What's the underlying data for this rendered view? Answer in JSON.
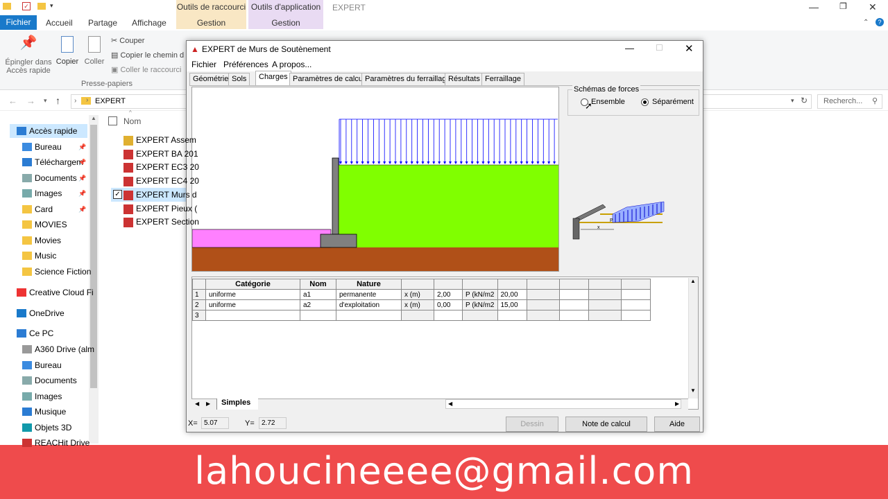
{
  "explorer": {
    "ctx_tabs": [
      {
        "label": "Outils de raccourci",
        "sub": "Gestion"
      },
      {
        "label": "Outils d'application",
        "sub": "Gestion"
      }
    ],
    "window_title": "EXPERT",
    "ribbon_tabs": [
      "Fichier",
      "Accueil",
      "Partage",
      "Affichage"
    ],
    "ribbon": {
      "pin_label": "Épingler dans Accès rapide",
      "copy_label": "Copier",
      "paste_label": "Coller",
      "cut_label": "Couper",
      "copy_path_label": "Copier le chemin d",
      "paste_shortcut_label": "Coller le raccourci",
      "group_label": "Presse-papiers"
    },
    "address": "EXPERT",
    "search_placeholder": "Recherch...",
    "nav_items": [
      {
        "label": "Accès rapide",
        "pinned": false
      },
      {
        "label": "Bureau",
        "pinned": true
      },
      {
        "label": "Téléchargem",
        "pinned": true
      },
      {
        "label": "Documents",
        "pinned": true
      },
      {
        "label": "Images",
        "pinned": true
      },
      {
        "label": "Card",
        "pinned": true
      },
      {
        "label": "MOVIES",
        "pinned": false
      },
      {
        "label": "Movies",
        "pinned": false
      },
      {
        "label": "Music",
        "pinned": false
      },
      {
        "label": "Science Fiction",
        "pinned": false
      },
      {
        "label": "Creative Cloud Fi",
        "pinned": false
      },
      {
        "label": "OneDrive",
        "pinned": false
      },
      {
        "label": "Ce PC",
        "pinned": false
      },
      {
        "label": "A360 Drive (alm",
        "pinned": false
      },
      {
        "label": "Bureau",
        "pinned": false
      },
      {
        "label": "Documents",
        "pinned": false
      },
      {
        "label": "Images",
        "pinned": false
      },
      {
        "label": "Musique",
        "pinned": false
      },
      {
        "label": "Objets 3D",
        "pinned": false
      },
      {
        "label": "REACHit Drive",
        "pinned": false
      }
    ],
    "column_name": "Nom",
    "files": [
      "EXPERT Assem",
      "EXPERT BA 201",
      "EXPERT EC3 20",
      "EXPERT EC4 20",
      "EXPERT Murs d",
      "EXPERT Pieux (",
      "EXPERT Section"
    ]
  },
  "expert": {
    "title": "EXPERT de Murs de Soutènement",
    "menu": [
      "Fichier",
      "Préférences",
      "A propos..."
    ],
    "tabs": [
      "Géométrie",
      "Sols",
      "Charges",
      "Paramètres de calcul",
      "Paramètres du ferraillage",
      "Résultats",
      "Ferraillage"
    ],
    "active_tab": "Charges",
    "forces_group": "Schémas de forces",
    "radio_ensemble": "Ensemble",
    "radio_separement": "Séparément",
    "table": {
      "headers": [
        "Catégorie",
        "Nom",
        "Nature"
      ],
      "rows": [
        {
          "n": "1",
          "cat": "uniforme",
          "nom": "a1",
          "nature": "permanente",
          "x": "x (m)",
          "xv": "2,00",
          "p": "P (kN/m2",
          "pv": "20,00"
        },
        {
          "n": "2",
          "cat": "uniforme",
          "nom": "a2",
          "nature": "d'exploitation",
          "x": "x (m)",
          "xv": "0,00",
          "p": "P (kN/m2",
          "pv": "15,00"
        },
        {
          "n": "3",
          "cat": "",
          "nom": "",
          "nature": "",
          "x": "",
          "xv": "",
          "p": "",
          "pv": ""
        }
      ]
    },
    "sheet_tab": "Simples",
    "status": {
      "x_label": "X=",
      "x_value": "5.07",
      "y_label": "Y=",
      "y_value": "2.72"
    },
    "buttons": {
      "draw": "Dessin",
      "note": "Note de calcul",
      "help": "Aide"
    },
    "colors": {
      "soil_green": "#80ff00",
      "ground_brown": "#b05018",
      "pink": "#ff80ff",
      "wall": "#808080",
      "load_blue": "#0000ff"
    }
  },
  "banner_text": "lahoucineeee@gmail.com"
}
